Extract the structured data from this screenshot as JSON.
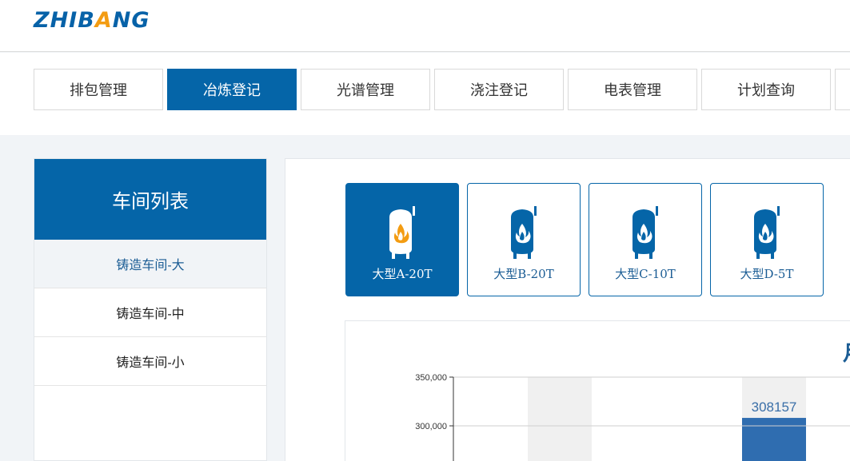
{
  "logo": {
    "part1": "ZHI",
    "part2": "B",
    "part3": "A",
    "part4": "NG"
  },
  "nav": {
    "tabs": [
      {
        "label": "排包管理",
        "active": false
      },
      {
        "label": "冶炼登记",
        "active": true
      },
      {
        "label": "光谱管理",
        "active": false
      },
      {
        "label": "浇注登记",
        "active": false
      },
      {
        "label": "电表管理",
        "active": false
      },
      {
        "label": "计划查询",
        "active": false
      }
    ]
  },
  "sidebar": {
    "title": "车间列表",
    "items": [
      {
        "label": "铸造车间-大",
        "active": true
      },
      {
        "label": "铸造车间-中",
        "active": false
      },
      {
        "label": "铸造车间-小",
        "active": false
      }
    ]
  },
  "furnaces": [
    {
      "label": "大型A-20T",
      "active": true
    },
    {
      "label": "大型B-20T",
      "active": false
    },
    {
      "label": "大型C-10T",
      "active": false
    },
    {
      "label": "大型D-5T",
      "active": false
    }
  ],
  "icons": {
    "furnace": "furnace-flame-icon"
  },
  "colors": {
    "primary": "#0565a8",
    "flame": "#f39c12",
    "bar": "#2f6db0",
    "bar_bg": "#f0f0f0"
  },
  "chart_data": {
    "type": "bar",
    "title": "月",
    "yticks": [
      {
        "value": 350000,
        "label": "350,000"
      },
      {
        "value": 300000,
        "label": "300,000"
      }
    ],
    "ylim_visible": [
      255000,
      350000
    ],
    "bars": [
      {
        "value": null,
        "background": true,
        "label": ""
      },
      {
        "value": 308157,
        "background": true,
        "label": "308157"
      }
    ]
  }
}
